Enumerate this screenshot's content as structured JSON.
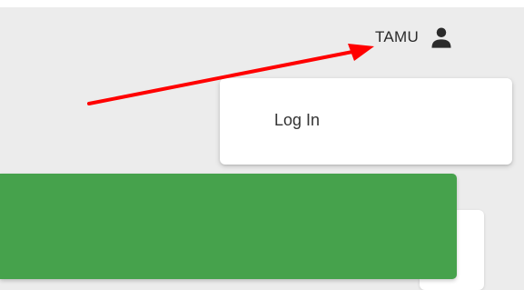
{
  "header": {
    "user_name": "TAMU",
    "user_icon": "user-icon"
  },
  "user_menu": {
    "items": [
      {
        "label": "Log In"
      }
    ]
  },
  "colors": {
    "page_background": "#ececec",
    "banner_green": "#46a24c",
    "annotation_red": "#ff0000"
  }
}
